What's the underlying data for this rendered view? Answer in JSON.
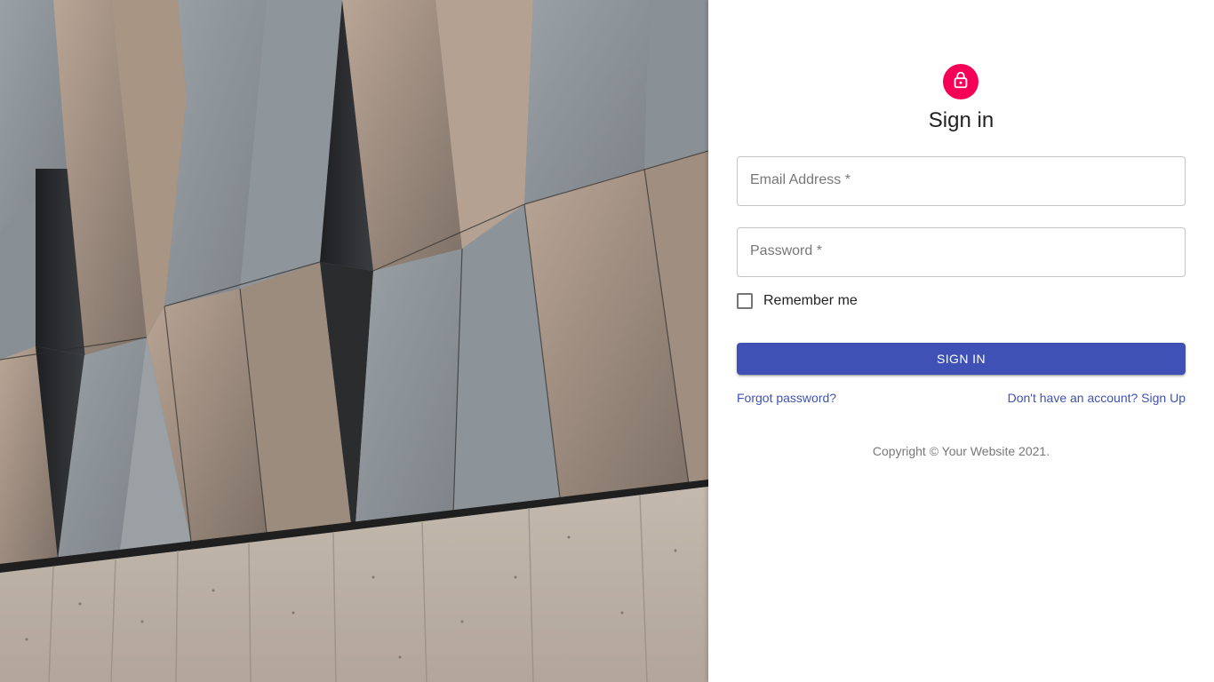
{
  "hero": {
    "description_icon": "architecture-photo"
  },
  "auth": {
    "icon": "lock-outline-icon",
    "title": "Sign in",
    "email_label": "Email Address *",
    "email_value": "",
    "password_label": "Password *",
    "password_value": "",
    "remember_label": "Remember me",
    "remember_checked": false,
    "submit_label": "SIGN IN",
    "forgot_link": "Forgot password?",
    "signup_link": "Don't have an account? Sign Up",
    "copyright": "Copyright © Your Website 2021."
  },
  "colors": {
    "accent": "#f50057",
    "primary": "#3f51b5"
  }
}
